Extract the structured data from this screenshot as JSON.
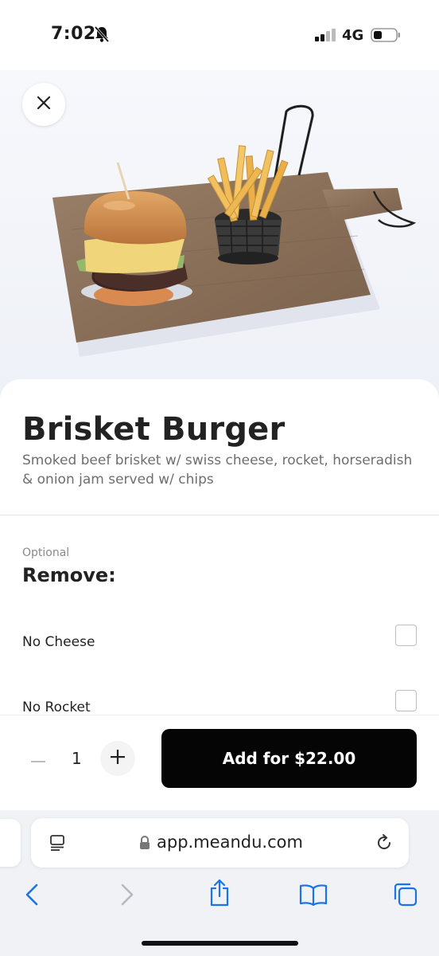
{
  "status_bar": {
    "time": "7:02",
    "network": "4G",
    "icons": [
      "bell-slash-icon",
      "signal-icon",
      "battery-icon"
    ]
  },
  "hero": {
    "image": "brisket-burger-with-fries-photo",
    "close_icon": "close-icon"
  },
  "item": {
    "title": "Brisket Burger",
    "description": "Smoked beef brisket w/ swiss cheese, rocket, horseradish & onion jam served w/ chips"
  },
  "options_group": {
    "optional_label": "Optional",
    "title": "Remove:",
    "options": [
      {
        "label": "No Cheese",
        "checked": false
      },
      {
        "label": "No Rocket",
        "checked": false
      }
    ]
  },
  "order": {
    "quantity": "1",
    "add_button_label": "Add for $22.00",
    "accent_color": "#050505"
  },
  "browser": {
    "url": "app.meandu.com",
    "toolbar_icons": [
      "back-icon",
      "forward-icon",
      "share-icon",
      "bookmarks-icon",
      "tabs-icon"
    ],
    "accent_color": "#1a73e8"
  }
}
